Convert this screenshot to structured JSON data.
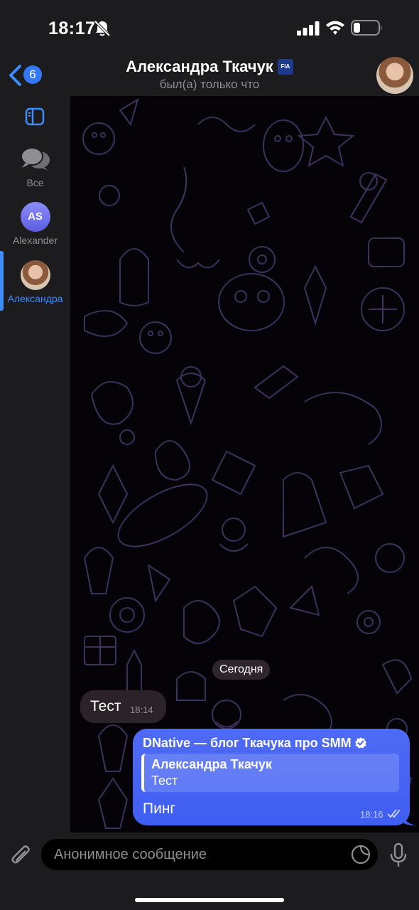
{
  "status_bar": {
    "time": "18:17",
    "icons": [
      "bell-slash-icon",
      "signal-icon",
      "wifi-icon",
      "battery-icon"
    ]
  },
  "header": {
    "back_count": "6",
    "title": "Александра Ткачук",
    "title_badge": "FIA",
    "status": "был(а) только что"
  },
  "sidebar": {
    "folders": [
      {
        "label": "Все",
        "icon": "chats-icon"
      },
      {
        "label": "Alexander",
        "initials": "AS"
      },
      {
        "label": "Александра",
        "active": true
      }
    ]
  },
  "chat": {
    "date_separator": "Сегодня",
    "messages": [
      {
        "direction": "in",
        "text": "Тест",
        "time": "18:14"
      },
      {
        "direction": "out",
        "forward_from": "DNative — блог Ткачука про SMM",
        "reply": {
          "name": "Александра Ткачук",
          "text": "Тест"
        },
        "text": "Пинг",
        "time": "18:16",
        "read": true
      }
    ]
  },
  "input": {
    "placeholder": "Анонимное сообщение"
  },
  "colors": {
    "accent": "#3d8bfd",
    "outgoing_bubble": "#4a66f3",
    "incoming_bubble": "#2c2229",
    "bar_background": "#1c1c1e"
  }
}
